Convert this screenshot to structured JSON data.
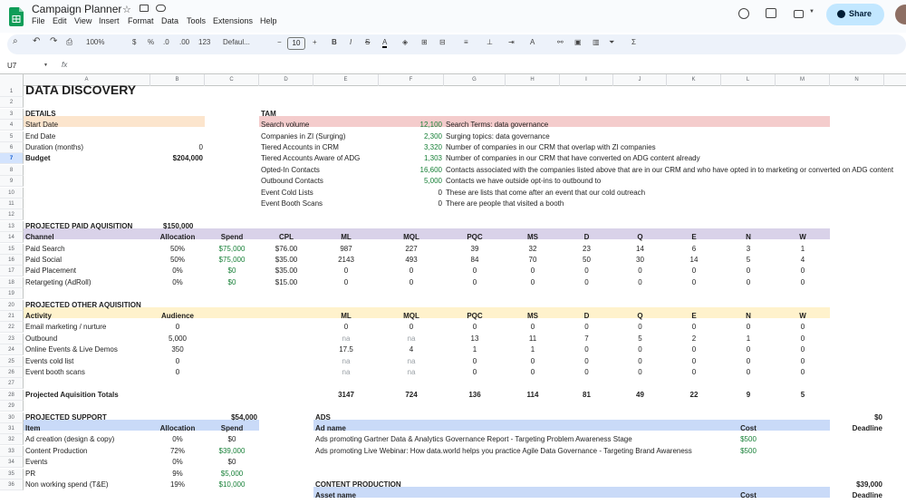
{
  "app": {
    "doc_title": "Campaign Planner",
    "menu": [
      "File",
      "Edit",
      "View",
      "Insert",
      "Format",
      "Data",
      "Tools",
      "Extensions",
      "Help"
    ],
    "share_label": "Share"
  },
  "toolbar": {
    "zoom": "100%",
    "currency": "$",
    "percent": "%",
    "dec_decrease": ".0",
    "dec_increase": ".00",
    "number_format": "123",
    "font": "Defaul...",
    "font_size": "10"
  },
  "formula_bar": {
    "cell_ref": "U7",
    "fx": "fx",
    "value": ""
  },
  "columns": [
    "A",
    "B",
    "C",
    "D",
    "E",
    "F",
    "G",
    "H",
    "I",
    "J",
    "K",
    "L",
    "M",
    "N"
  ],
  "rows": [
    "1",
    "2",
    "3",
    "4",
    "5",
    "6",
    "7",
    "8",
    "9",
    "10",
    "11",
    "12",
    "13",
    "14",
    "15",
    "16",
    "17",
    "18",
    "19",
    "20",
    "21",
    "22",
    "23",
    "24",
    "25",
    "26",
    "27",
    "28",
    "29",
    "30",
    "31",
    "32",
    "33",
    "34",
    "35",
    "36"
  ],
  "colors": {
    "details_band": "#fce5cd",
    "tam_band": "#f4cccc",
    "paid_band": "#d9d2e9",
    "other_band": "#fff2cc",
    "support_band": "#c9daf8",
    "ads_band": "#c9daf8",
    "content_band": "#c9daf8",
    "green_text": "#188038",
    "share_button": "#c2e7ff"
  },
  "sheet": {
    "title": "DATA DISCOVERY",
    "details": {
      "header": "DETAILS",
      "rows": [
        {
          "label": "Start Date",
          "value": ""
        },
        {
          "label": "End Date",
          "value": ""
        },
        {
          "label": "Duration (months)",
          "value": "0"
        },
        {
          "label": "Budget",
          "value": "$204,000"
        }
      ]
    },
    "tam": {
      "header": "TAM",
      "rows": [
        {
          "label": "Search volume",
          "value": "12,100",
          "note": "Search Terms: data governance",
          "green": true
        },
        {
          "label": "Companies in ZI (Surging)",
          "value": "2,300",
          "note": "Surging topics: data governance",
          "green": true
        },
        {
          "label": "Tiered Accounts in CRM",
          "value": "3,320",
          "note": "Number of companies in our CRM that overlap with ZI companies",
          "green": true
        },
        {
          "label": "Tiered Accounts Aware of ADG",
          "value": "1,303",
          "note": "Number of companies in our CRM that have converted on ADG content already",
          "green": true
        },
        {
          "label": "Opted-In Contacts",
          "value": "16,600",
          "note": "Contacts associated with the companies listed above that are in our CRM and who have opted in to marketing or converted on ADG content",
          "green": true
        },
        {
          "label": "Outbound Contacts",
          "value": "5,000",
          "note": "Contacts we have outside opt-ins to outbound to",
          "green": true
        },
        {
          "label": "Event Cold Lists",
          "value": "0",
          "note": "These are lists that come after an event that our cold outreach",
          "green": false
        },
        {
          "label": "Event Booth Scans",
          "value": "0",
          "note": "There are people that visited a booth",
          "green": false
        }
      ]
    },
    "paid": {
      "header": "PROJECTED PAID AQUISITION",
      "budget": "$150,000",
      "columns": [
        "Channel",
        "Allocation",
        "Spend",
        "CPL",
        "ML",
        "MQL",
        "PQC",
        "MS",
        "D",
        "Q",
        "E",
        "N",
        "W"
      ],
      "rows": [
        [
          "Paid Search",
          "50%",
          "$75,000",
          "$76.00",
          "987",
          "227",
          "39",
          "32",
          "23",
          "14",
          "6",
          "3",
          "1"
        ],
        [
          "Paid Social",
          "50%",
          "$75,000",
          "$35.00",
          "2143",
          "493",
          "84",
          "70",
          "50",
          "30",
          "14",
          "5",
          "4"
        ],
        [
          "Paid Placement",
          "0%",
          "$0",
          "$35.00",
          "0",
          "0",
          "0",
          "0",
          "0",
          "0",
          "0",
          "0",
          "0"
        ],
        [
          "Retargeting (AdRoll)",
          "0%",
          "$0",
          "$15.00",
          "0",
          "0",
          "0",
          "0",
          "0",
          "0",
          "0",
          "0",
          "0"
        ]
      ]
    },
    "other": {
      "header": "PROJECTED OTHER AQUISITION",
      "columns": [
        "Activity",
        "Audience",
        "ML",
        "MQL",
        "PQC",
        "MS",
        "D",
        "Q",
        "E",
        "N",
        "W"
      ],
      "rows": [
        [
          "Email marketing / nurture",
          "0",
          "0",
          "0",
          "0",
          "0",
          "0",
          "0",
          "0",
          "0",
          "0"
        ],
        [
          "Outbound",
          "5,000",
          "na",
          "na",
          "13",
          "11",
          "7",
          "5",
          "2",
          "1",
          "0"
        ],
        [
          "Online Events & Live Demos",
          "350",
          "17.5",
          "4",
          "1",
          "1",
          "0",
          "0",
          "0",
          "0",
          "0"
        ],
        [
          "Events cold list",
          "0",
          "na",
          "na",
          "0",
          "0",
          "0",
          "0",
          "0",
          "0",
          "0"
        ],
        [
          "Event booth scans",
          "0",
          "na",
          "na",
          "0",
          "0",
          "0",
          "0",
          "0",
          "0",
          "0"
        ]
      ],
      "totals_label": "Projected Aquisition Totals",
      "totals": [
        "3147",
        "724",
        "136",
        "114",
        "81",
        "49",
        "22",
        "9",
        "5"
      ]
    },
    "support": {
      "header": "PROJECTED SUPPORT",
      "budget": "$54,000",
      "columns": [
        "Item",
        "Allocation",
        "Spend"
      ],
      "rows": [
        [
          "Ad creation (design & copy)",
          "0%",
          "$0"
        ],
        [
          "Content Production",
          "72%",
          "$39,000"
        ],
        [
          "Events",
          "0%",
          "$0"
        ],
        [
          "PR",
          "9%",
          "$5,000"
        ],
        [
          "Non working spend (T&E)",
          "19%",
          "$10,000"
        ]
      ]
    },
    "ads": {
      "header": "ADS",
      "total": "$0",
      "columns": [
        "Ad name",
        "Cost",
        "Deadline"
      ],
      "rows": [
        [
          "Ads promoting Gartner Data & Analytics Governance Report - Targeting Problem Awareness Stage",
          "$500",
          ""
        ],
        [
          "Ads promoting Live Webinar: How data.world helps you practice Agile Data Governance - Targeting Brand Awareness",
          "$500",
          ""
        ]
      ]
    },
    "content": {
      "header": "CONTENT PRODUCTION",
      "total": "$39,000",
      "columns": [
        "Asset name",
        "Cost",
        "Deadline"
      ]
    }
  }
}
